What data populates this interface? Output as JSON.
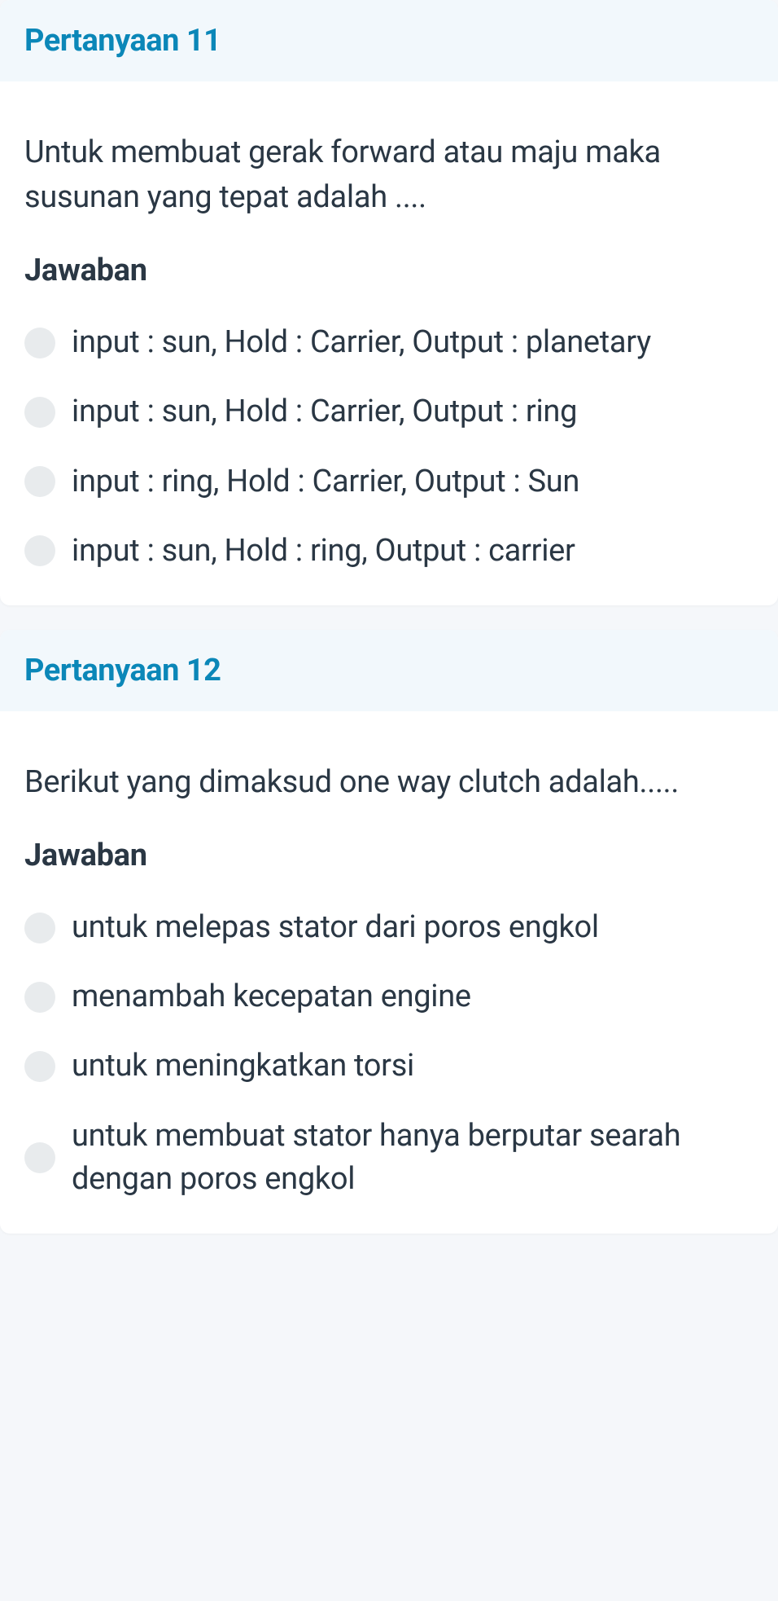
{
  "questions": [
    {
      "title": "Pertanyaan 11",
      "text": "Untuk membuat gerak forward atau maju maka susunan yang tepat adalah ....",
      "answer_label": "Jawaban",
      "options": [
        "input : sun, Hold : Carrier, Output : planetary",
        "input : sun, Hold : Carrier, Output : ring",
        "input : ring, Hold : Carrier, Output : Sun",
        "input : sun, Hold : ring, Output : carrier"
      ]
    },
    {
      "title": "Pertanyaan 12",
      "text": "Berikut yang dimaksud one way clutch adalah.....",
      "answer_label": "Jawaban",
      "options": [
        "untuk melepas stator dari poros engkol",
        "menambah kecepatan engine",
        "untuk meningkatkan torsi",
        "untuk membuat stator hanya berputar searah dengan poros engkol"
      ]
    }
  ]
}
